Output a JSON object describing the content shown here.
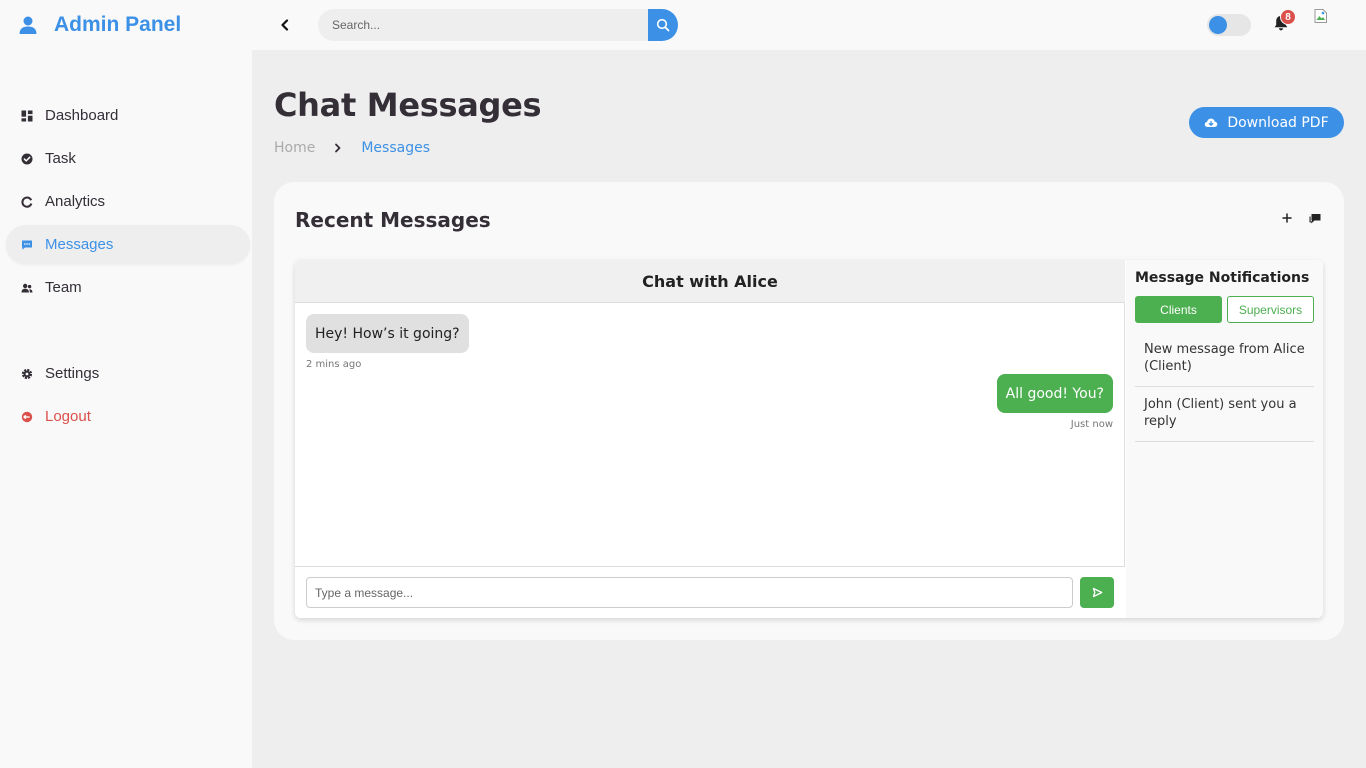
{
  "brand": {
    "title": "Admin Panel"
  },
  "search": {
    "placeholder": "Search..."
  },
  "notifications_badge": "8",
  "colors": {
    "accent": "#3c91e6",
    "danger": "#db504a",
    "success": "#4caf50"
  },
  "sidebar": {
    "items": [
      {
        "label": "Dashboard",
        "icon": "dashboard-icon"
      },
      {
        "label": "Task",
        "icon": "check-circle-icon"
      },
      {
        "label": "Analytics",
        "icon": "analytics-icon"
      },
      {
        "label": "Messages",
        "icon": "message-icon",
        "active": true
      },
      {
        "label": "Team",
        "icon": "team-icon"
      }
    ],
    "bottom": [
      {
        "label": "Settings",
        "icon": "gear-icon"
      },
      {
        "label": "Logout",
        "icon": "logout-icon"
      }
    ]
  },
  "page": {
    "title": "Chat Messages",
    "breadcrumb": {
      "home": "Home",
      "current": "Messages"
    },
    "download_label": "Download PDF"
  },
  "card": {
    "title": "Recent Messages",
    "chat": {
      "header": "Chat with Alice",
      "messages": [
        {
          "text": "Hey! How’s it going?",
          "time": "2 mins ago",
          "direction": "incoming"
        },
        {
          "text": "All good! You?",
          "time": "Just now",
          "direction": "outgoing"
        }
      ],
      "input_placeholder": "Type a message..."
    },
    "notifications": {
      "title": "Message Notifications",
      "tabs": [
        "Clients",
        "Supervisors"
      ],
      "active_tab": "Clients",
      "items": [
        "New message from Alice (Client)",
        "John (Client) sent you a reply"
      ]
    }
  }
}
